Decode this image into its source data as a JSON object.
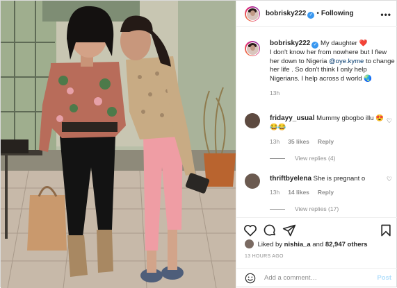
{
  "header": {
    "username": "bobrisky222",
    "separator": "•",
    "follow_state": "Following",
    "more_icon": "more-horizontal-icon",
    "verified_mark": "✓"
  },
  "caption": {
    "username": "bobrisky222",
    "text_part1": "My daughter ❤️",
    "text_part2": "I don't know her from nowhere but I flew her down to Nigeria",
    "mention": "@oye.kyme",
    "text_part3": "to change her life . So don't think I only help Nigerians. I help across d world 🌏",
    "time": "13h"
  },
  "comments": [
    {
      "username": "fridayy_usual",
      "text": "Mummy gbogbo illu 😍😂😂",
      "time": "13h",
      "likes": "35 likes",
      "reply": "Reply",
      "view_replies": "View replies (4)"
    },
    {
      "username": "thriftbyelena",
      "text": "She is pregnant o",
      "time": "13h",
      "likes": "14 likes",
      "reply": "Reply",
      "view_replies": "View replies (17)"
    }
  ],
  "actions": {
    "like_icon": "heart-icon",
    "comment_icon": "comment-icon",
    "share_icon": "share-icon",
    "save_icon": "bookmark-icon",
    "liked_by_prefix": "Liked by",
    "liked_by_user": "nishia_a",
    "liked_by_and": "and",
    "liked_by_count": "82,947 others",
    "timestamp": "13 HOURS AGO"
  },
  "add_comment": {
    "placeholder": "Add a comment…",
    "post_label": "Post",
    "emoji_icon": "smile-icon"
  },
  "colors": {
    "accent": "#3897f0",
    "mention": "#00376b",
    "muted": "#8e8e8e",
    "post_disabled": "#b2dffc"
  }
}
